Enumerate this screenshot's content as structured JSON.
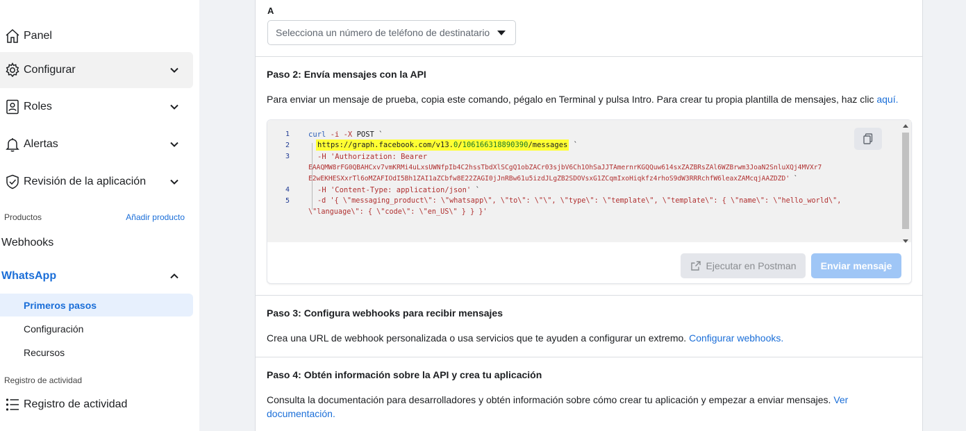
{
  "sidebar": {
    "nav": [
      {
        "label": "Panel",
        "icon": "home-icon"
      },
      {
        "label": "Configurar",
        "icon": "gear-icon"
      },
      {
        "label": "Roles",
        "icon": "user-badge-icon"
      },
      {
        "label": "Alertas",
        "icon": "bell-icon"
      },
      {
        "label": "Revisión de la aplicación",
        "icon": "shield-check-icon"
      }
    ],
    "products_label": "Productos",
    "add_product": "Añadir producto",
    "webhooks": "Webhooks",
    "whatsapp": "WhatsApp",
    "whatsapp_sub": [
      "Primeros pasos",
      "Configuración",
      "Recursos"
    ],
    "activity_label": "Registro de actividad",
    "activity_item": "Registro de actividad"
  },
  "main": {
    "to_label": "A",
    "to_placeholder": "Selecciona un número de teléfono de destinatario",
    "step2": {
      "title": "Paso 2: Envía mensajes con la API",
      "text": "Para enviar un mensaje de prueba, copia este comando, pégalo en Terminal y pulsa Intro. Para crear tu propia plantilla de mensajes, haz clic ",
      "link": "aquí",
      "period": ".",
      "code": {
        "line1": {
          "n": "1",
          "curl": "curl",
          "flags": "-i -X",
          "method": "POST `"
        },
        "line2": {
          "n": "2",
          "url_a": "https://graph.facebook.com/v13.",
          "url_b": "0",
          "url_c": "/",
          "url_d": "106166318890390",
          "url_e": "/messages",
          "tail": " `"
        },
        "line3": {
          "n": "3",
          "text": "-H 'Authorization: Bearer",
          "token1": "EAAQMW8rFG0QBAHCxv7vmKRMi4uLxsUWNfpIb4C2hssTbdXlSCgQ1obZACr03sjbV6Ch1OhSaJJTAmernrKGQQuw614sxZAZBRsZAl6WZBrwm3JoaN2SnluXQj4MVXr7",
          "token2": "E2wEKHESXxrTl6oMZAFIOdI5Bh1ZAI1aZCbfw8E22ZAGI0jJnRBw61u5izdJLgZB2SDOVsxG1ZCqmIxoHiqkfz4rhoS9dW3RRRchfW6leaxZAMcqjAAZDZD'",
          "tail": " `"
        },
        "line4": {
          "n": "4",
          "text": "-H 'Content-Type: application/json'",
          "tail": " `"
        },
        "line5": {
          "n": "5",
          "text": "-d '{ \\\"messaging_product\\\": \\\"whatsapp\\\", \\\"to\\\": \\\"\\\", \\\"type\\\": \\\"template\\\", \\\"template\\\": { \\\"name\\\": \\\"hello_world\\\",",
          "text2": "\\\"language\\\": { \\\"code\\\": \\\"en_US\\\" } } }'"
        }
      },
      "postman_button": "Ejecutar en Postman",
      "send_button": "Enviar mensaje"
    },
    "step3": {
      "title": "Paso 3: Configura webhooks para recibir mensajes",
      "text": "Crea una URL de webhook personalizada o usa servicios que te ayuden a configurar un extremo. ",
      "link": "Configurar webhooks."
    },
    "step4": {
      "title": "Paso 4: Obtén información sobre la API y crea tu aplicación",
      "text": "Consulta la documentación para desarrolladores y obtén información sobre cómo crear tu aplicación y empezar a enviar mensajes. ",
      "link1": "Ver",
      "link2": "documentación."
    }
  },
  "colors": {
    "accent": "#1a6ed8",
    "highlight": "#ffff33",
    "send_disabled": "#9fc6f6"
  }
}
